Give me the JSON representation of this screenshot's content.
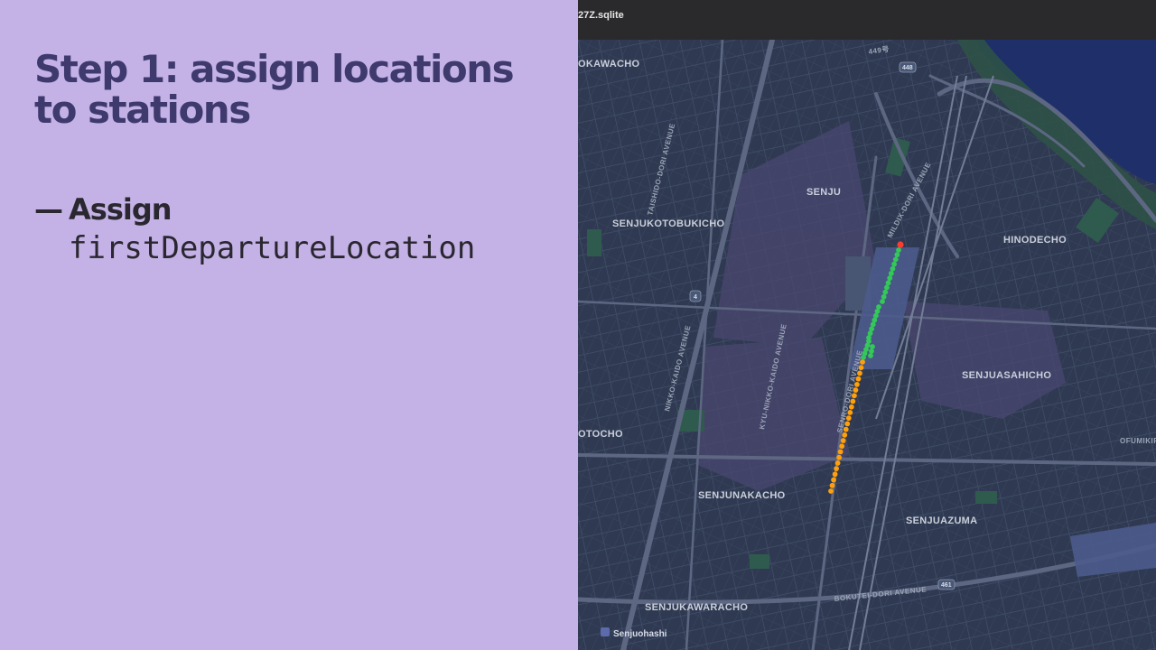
{
  "slide": {
    "title": "Step 1: assign locations to stations",
    "bullet_dash": "—",
    "bullet_word": "Assign",
    "bullet_code": "firstDepartureLocation"
  },
  "window": {
    "title": "27Z.sqlite"
  },
  "map": {
    "areas": {
      "okawacho": "OKAWACHO",
      "senju": "SENJU",
      "senjukotobukicho": "SENJUKOTOBUKICHO",
      "hinodecho": "HINODECHO",
      "senjuasahicho": "SENJUASAHICHO",
      "otocho": "OTOCHO",
      "senjunakacho": "SENJUNAKACHO",
      "senjuazuma": "SENJUAZUMA",
      "senjukawaracho": "SENJUKAWARACHO",
      "ofumikir": "OFUMIKIR"
    },
    "roads": {
      "taishido": "TAISHIDO-DORI AVENUE",
      "mildix": "MILDIX-DORI AVENUE",
      "nikko_kaido": "NIKKO-KAIDO AVENUE",
      "kyu_nikko": "KYU-NIKKO-KAIDO AVENUE",
      "senro": "SENRO-DORI AVENUE",
      "bokutei": "BOKUTEI-DORI AVENUE",
      "route_449": "449号"
    },
    "shields": {
      "r448": "448",
      "r4": "4",
      "r461": "461"
    },
    "poi": {
      "senjuohashi": "Senjuohashi"
    },
    "colors": {
      "background": "#2f3a52",
      "start_point": "#ff3b30",
      "green_track": "#34c759",
      "orange_track": "#ff9f0a",
      "station": "#4b5b8c"
    }
  }
}
